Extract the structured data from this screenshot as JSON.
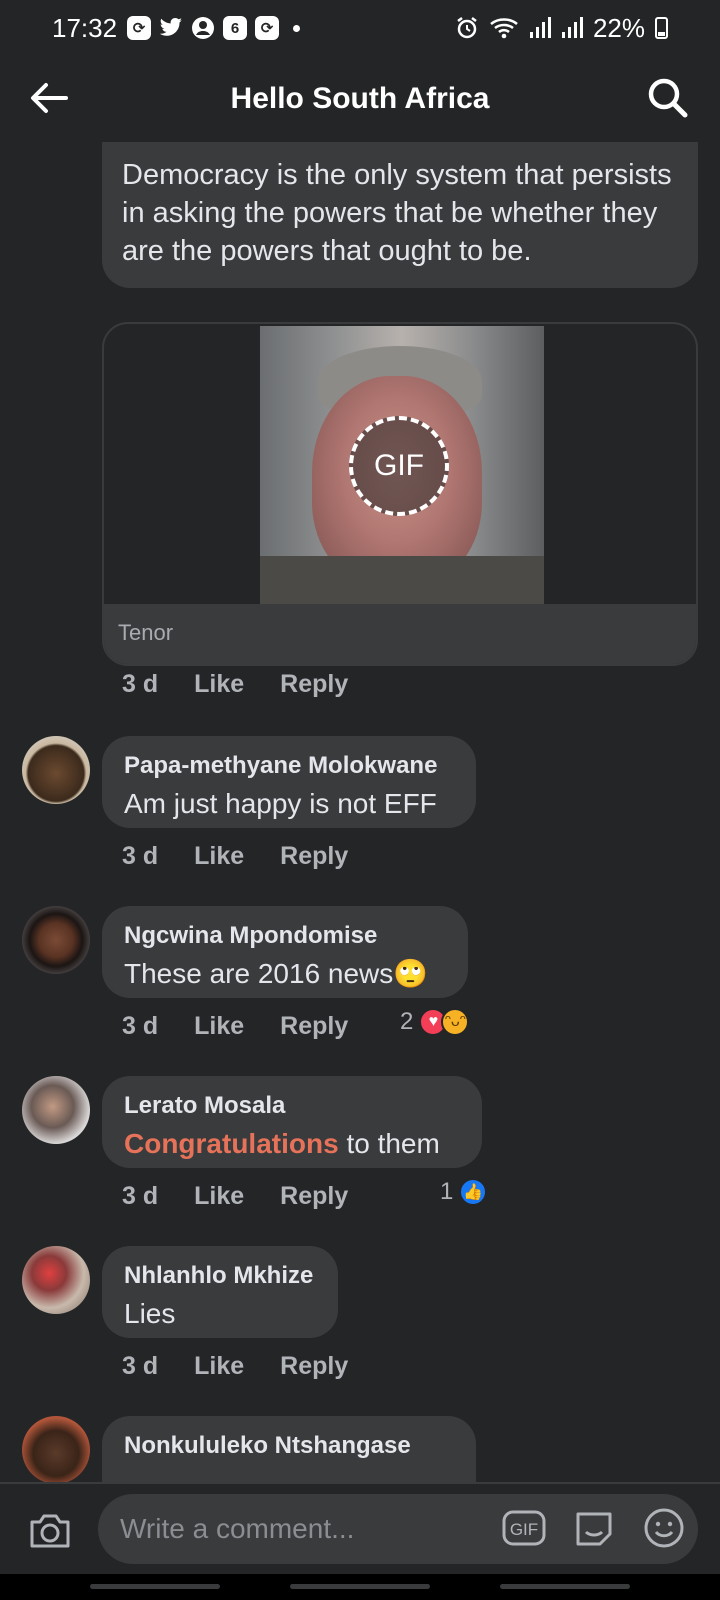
{
  "status_bar": {
    "time": "17:32",
    "battery": "22%",
    "notification_icons": [
      "sync-icon",
      "twitter-icon",
      "account-icon",
      "calendar-icon",
      "sync-icon"
    ],
    "calendar_day": "6"
  },
  "header": {
    "title": "Hello South Africa"
  },
  "top_comment": {
    "text": "Democracy is the only system that persists in asking the powers that be whether they are the powers that ought to be.",
    "gif_badge": "GIF",
    "gif_source": "Tenor",
    "time": "3 d",
    "like": "Like",
    "reply": "Reply"
  },
  "comments": [
    {
      "name": "Papa-methyane Molokwane",
      "text": "Am just happy is not EFF",
      "time": "3 d",
      "like": "Like",
      "reply": "Reply"
    },
    {
      "name": "Ngcwina Mpondomise",
      "text": "These are 2016 news",
      "emoji": "🙄",
      "time": "3 d",
      "like": "Like",
      "reply": "Reply",
      "reaction_count": "2",
      "reactions": [
        "love",
        "haha"
      ]
    },
    {
      "name": "Lerato Mosala",
      "text_highlight": "Congratulations",
      "text_rest": " to them",
      "time": "3 d",
      "like": "Like",
      "reply": "Reply",
      "reaction_count": "1",
      "reactions": [
        "like"
      ]
    },
    {
      "name": "Nhlanhlo Mkhize",
      "text": "Lies",
      "time": "3 d",
      "like": "Like",
      "reply": "Reply"
    },
    {
      "name": "Nonkululeko Ntshangase"
    }
  ],
  "composer": {
    "placeholder": "Write a comment...",
    "gif_label": "GIF"
  },
  "colors": {
    "background": "#242526",
    "bubble": "#3a3b3c",
    "highlight": "#e6725a",
    "like_blue": "#1877f2",
    "love_red": "#f33e58"
  }
}
